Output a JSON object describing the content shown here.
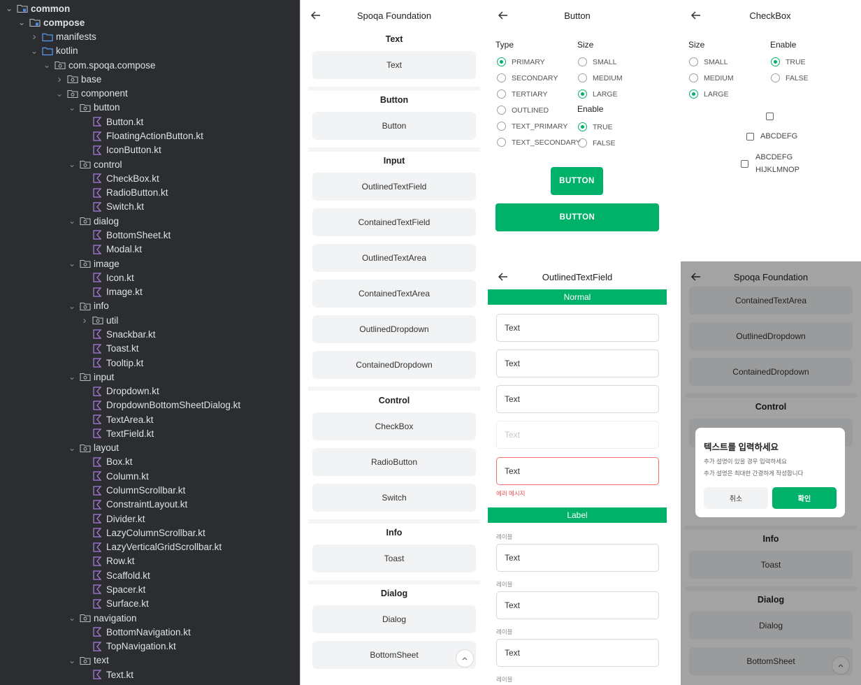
{
  "tree": [
    {
      "label": "common",
      "depth": 0,
      "chev": "open",
      "icon": "folder-module-icon",
      "bold": true
    },
    {
      "label": "compose",
      "depth": 1,
      "chev": "open",
      "icon": "folder-module-icon",
      "bold": true
    },
    {
      "label": "manifests",
      "depth": 2,
      "chev": "closed",
      "icon": "folder-icon"
    },
    {
      "label": "kotlin",
      "depth": 2,
      "chev": "open",
      "icon": "folder-icon"
    },
    {
      "label": "com.spoqa.compose",
      "depth": 3,
      "chev": "open",
      "icon": "package-icon"
    },
    {
      "label": "base",
      "depth": 4,
      "chev": "closed",
      "icon": "package-icon"
    },
    {
      "label": "component",
      "depth": 4,
      "chev": "open",
      "icon": "package-icon"
    },
    {
      "label": "button",
      "depth": 5,
      "chev": "open",
      "icon": "package-icon"
    },
    {
      "label": "Button.kt",
      "depth": 6,
      "chev": "none",
      "icon": "kotlin-file-icon"
    },
    {
      "label": "FloatingActionButton.kt",
      "depth": 6,
      "chev": "none",
      "icon": "kotlin-file-icon"
    },
    {
      "label": "IconButton.kt",
      "depth": 6,
      "chev": "none",
      "icon": "kotlin-file-icon"
    },
    {
      "label": "control",
      "depth": 5,
      "chev": "open",
      "icon": "package-icon"
    },
    {
      "label": "CheckBox.kt",
      "depth": 6,
      "chev": "none",
      "icon": "kotlin-file-icon"
    },
    {
      "label": "RadioButton.kt",
      "depth": 6,
      "chev": "none",
      "icon": "kotlin-file-icon"
    },
    {
      "label": "Switch.kt",
      "depth": 6,
      "chev": "none",
      "icon": "kotlin-file-icon"
    },
    {
      "label": "dialog",
      "depth": 5,
      "chev": "open",
      "icon": "package-icon"
    },
    {
      "label": "BottomSheet.kt",
      "depth": 6,
      "chev": "none",
      "icon": "kotlin-file-icon"
    },
    {
      "label": "Modal.kt",
      "depth": 6,
      "chev": "none",
      "icon": "kotlin-file-icon"
    },
    {
      "label": "image",
      "depth": 5,
      "chev": "open",
      "icon": "package-icon"
    },
    {
      "label": "Icon.kt",
      "depth": 6,
      "chev": "none",
      "icon": "kotlin-file-icon"
    },
    {
      "label": "Image.kt",
      "depth": 6,
      "chev": "none",
      "icon": "kotlin-file-icon"
    },
    {
      "label": "info",
      "depth": 5,
      "chev": "open",
      "icon": "package-icon"
    },
    {
      "label": "util",
      "depth": 6,
      "chev": "closed",
      "icon": "package-icon"
    },
    {
      "label": "Snackbar.kt",
      "depth": 6,
      "chev": "none",
      "icon": "kotlin-file-icon"
    },
    {
      "label": "Toast.kt",
      "depth": 6,
      "chev": "none",
      "icon": "kotlin-file-icon"
    },
    {
      "label": "Tooltip.kt",
      "depth": 6,
      "chev": "none",
      "icon": "kotlin-file-icon"
    },
    {
      "label": "input",
      "depth": 5,
      "chev": "open",
      "icon": "package-icon"
    },
    {
      "label": "Dropdown.kt",
      "depth": 6,
      "chev": "none",
      "icon": "kotlin-file-icon"
    },
    {
      "label": "DropdownBottomSheetDialog.kt",
      "depth": 6,
      "chev": "none",
      "icon": "kotlin-file-icon"
    },
    {
      "label": "TextArea.kt",
      "depth": 6,
      "chev": "none",
      "icon": "kotlin-file-icon"
    },
    {
      "label": "TextField.kt",
      "depth": 6,
      "chev": "none",
      "icon": "kotlin-file-icon"
    },
    {
      "label": "layout",
      "depth": 5,
      "chev": "open",
      "icon": "package-icon"
    },
    {
      "label": "Box.kt",
      "depth": 6,
      "chev": "none",
      "icon": "kotlin-file-icon"
    },
    {
      "label": "Column.kt",
      "depth": 6,
      "chev": "none",
      "icon": "kotlin-file-icon"
    },
    {
      "label": "ColumnScrollbar.kt",
      "depth": 6,
      "chev": "none",
      "icon": "kotlin-file-icon"
    },
    {
      "label": "ConstraintLayout.kt",
      "depth": 6,
      "chev": "none",
      "icon": "kotlin-file-icon"
    },
    {
      "label": "Divider.kt",
      "depth": 6,
      "chev": "none",
      "icon": "kotlin-file-icon"
    },
    {
      "label": "LazyColumnScrollbar.kt",
      "depth": 6,
      "chev": "none",
      "icon": "kotlin-file-icon"
    },
    {
      "label": "LazyVerticalGridScrollbar.kt",
      "depth": 6,
      "chev": "none",
      "icon": "kotlin-file-icon"
    },
    {
      "label": "Row.kt",
      "depth": 6,
      "chev": "none",
      "icon": "kotlin-file-icon"
    },
    {
      "label": "Scaffold.kt",
      "depth": 6,
      "chev": "none",
      "icon": "kotlin-file-icon"
    },
    {
      "label": "Spacer.kt",
      "depth": 6,
      "chev": "none",
      "icon": "kotlin-file-icon"
    },
    {
      "label": "Surface.kt",
      "depth": 6,
      "chev": "none",
      "icon": "kotlin-file-icon"
    },
    {
      "label": "navigation",
      "depth": 5,
      "chev": "open",
      "icon": "package-icon"
    },
    {
      "label": "BottomNavigation.kt",
      "depth": 6,
      "chev": "none",
      "icon": "kotlin-file-icon"
    },
    {
      "label": "TopNavigation.kt",
      "depth": 6,
      "chev": "none",
      "icon": "kotlin-file-icon"
    },
    {
      "label": "text",
      "depth": 5,
      "chev": "open",
      "icon": "package-icon"
    },
    {
      "label": "Text.kt",
      "depth": 6,
      "chev": "none",
      "icon": "kotlin-file-icon"
    }
  ],
  "colors": {
    "accent": "#00b16a",
    "tree_bg": "#2b2d30",
    "tree_text": "#dfe1e5",
    "error": "#f26d6d",
    "kotlin_icon": "#a77bd9"
  },
  "icons": {
    "back": "arrow-left-icon",
    "scroll_top": "chevron-up-icon"
  },
  "foundation": {
    "title": "Spoqa Foundation",
    "sections": {
      "text": "Text",
      "button": "Button",
      "input": "Input",
      "control": "Control",
      "info": "Info",
      "dialog": "Dialog"
    },
    "buttons": {
      "text": "Text",
      "button": "Button",
      "outlined_text_field": "OutlinedTextField",
      "contained_text_field": "ContainedTextField",
      "outlined_text_area": "OutlinedTextArea",
      "contained_text_area": "ContainedTextArea",
      "outlined_dropdown": "OutlinedDropdown",
      "contained_dropdown": "ContainedDropdown",
      "checkbox": "CheckBox",
      "radio_button": "RadioButton",
      "switch": "Switch",
      "toast": "Toast",
      "dialog": "Dialog",
      "bottom_sheet": "BottomSheet"
    }
  },
  "button_screen": {
    "title": "Button",
    "type_label": "Type",
    "size_label": "Size",
    "enable_label": "Enable",
    "types": [
      "PRIMARY",
      "SECONDARY",
      "TERTIARY",
      "OUTLINED",
      "TEXT_PRIMARY",
      "TEXT_SECONDARY"
    ],
    "type_selected": "PRIMARY",
    "sizes": [
      "SMALL",
      "MEDIUM",
      "LARGE"
    ],
    "size_selected": "LARGE",
    "enables": [
      "TRUE",
      "FALSE"
    ],
    "enable_selected": "TRUE",
    "sample_small": "BUTTON",
    "sample_wide": "BUTTON"
  },
  "checkbox_screen": {
    "title": "CheckBox",
    "size_label": "Size",
    "enable_label": "Enable",
    "sizes": [
      "SMALL",
      "MEDIUM",
      "LARGE"
    ],
    "size_selected": "LARGE",
    "enables": [
      "TRUE",
      "FALSE"
    ],
    "enable_selected": "TRUE",
    "sample_text": "ABCDEFG",
    "sample_multi_1": "ABCDEFG",
    "sample_multi_2": "HIJKLMNOP"
  },
  "textfield_screen": {
    "title": "OutlinedTextField",
    "normal_header": "Normal",
    "label_header": "Label",
    "fields": [
      "Text",
      "Text",
      "Text",
      "Text",
      "Text"
    ],
    "error_message": "에러 메시지",
    "field_label": "레이블",
    "label_fields": [
      "Text",
      "Text",
      "Text"
    ]
  },
  "dialog_screen": {
    "title": "Spoqa Foundation",
    "bg_buttons": [
      "ContainedTextArea",
      "OutlinedDropdown",
      "ContainedDropdown"
    ],
    "control_section": "Control",
    "info_section": "Info",
    "toast_button": "Toast",
    "dialog_section": "Dialog",
    "dialog_button": "Dialog",
    "bottom_sheet_button": "BottomSheet",
    "modal": {
      "title": "텍스트를 입력하세요",
      "line1": "추가 설명이 있을 경우 입력하세요",
      "line2": "추가 설명은 최대한 간결하게 작성합니다",
      "cancel": "취소",
      "confirm": "확인"
    }
  }
}
